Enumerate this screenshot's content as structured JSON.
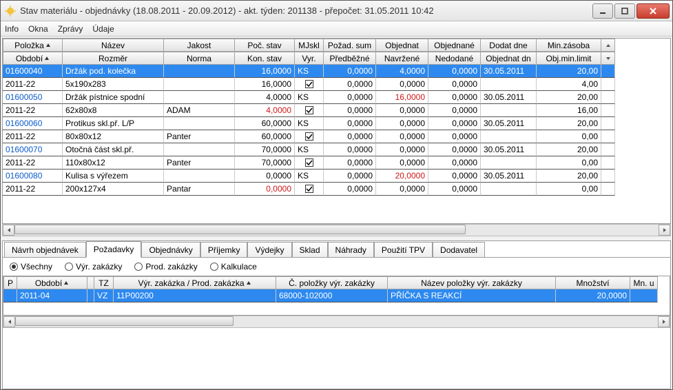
{
  "window": {
    "title": "Stav materiálu - objednávky (18.08.2011 - 20.09.2012) - akt. týden: 201138 - přepočet: 31.05.2011 10:42"
  },
  "menu": {
    "info": "Info",
    "okna": "Okna",
    "zpravy": "Zprávy",
    "udaje": "Údaje"
  },
  "hdr1": {
    "c0": "Položka",
    "c1": "Název",
    "c2": "Jakost",
    "c3": "Poč. stav",
    "c4": "MJskl",
    "c5": "Požad. sum",
    "c6": "Objednat",
    "c7": "Objednané",
    "c8": "Dodat dne",
    "c9": "Min.zásoba"
  },
  "hdr2": {
    "c0": "Období",
    "c1": "Rozměr",
    "c2": "Norma",
    "c3": "Kon. stav",
    "c4": "Vyr.",
    "c5": "Předběžné",
    "c6": "Navržené",
    "c7": "Nedodané",
    "c8": "Objednat dn",
    "c9": "Obj.min.limit"
  },
  "rows": [
    {
      "a": {
        "c0": "01600040",
        "c1": "Držák pod. kolečka",
        "c2": "",
        "c3": "16,0000",
        "c4": "KS",
        "c5": "0,0000",
        "c6": "4,0000",
        "c7": "0,0000",
        "c8": "30.05.2011",
        "c9": "20,00",
        "sel": true
      },
      "b": {
        "c0": "2011-22",
        "c1": "5x190x283",
        "c2": "",
        "c3": "16,0000",
        "chk": true,
        "c5": "0,0000",
        "c6": "0,0000",
        "c7": "0,0000",
        "c8": "",
        "c9": "4,00"
      }
    },
    {
      "a": {
        "c0": "01600050",
        "c1": "Držák pístnice spodní",
        "c2": "",
        "c3": "4,0000",
        "c4": "KS",
        "c5": "0,0000",
        "c6": "16,0000",
        "c6red": true,
        "c7": "0,0000",
        "c8": "30.05.2011",
        "c9": "20,00"
      },
      "b": {
        "c0": "2011-22",
        "c1": "62x80x8",
        "c2": "ADAM",
        "c3": "4,0000",
        "c3red": true,
        "chk": true,
        "c5": "0,0000",
        "c6": "0,0000",
        "c7": "0,0000",
        "c8": "",
        "c9": "16,00"
      }
    },
    {
      "a": {
        "c0": "01600060",
        "c1": "Protikus skl.př. L/P",
        "c2": "",
        "c3": "60,0000",
        "c4": "KS",
        "c5": "0,0000",
        "c6": "0,0000",
        "c7": "0,0000",
        "c8": "30.05.2011",
        "c9": "20,00"
      },
      "b": {
        "c0": "2011-22",
        "c1": "80x80x12",
        "c2": "Panter",
        "c3": "60,0000",
        "chk": true,
        "c5": "0,0000",
        "c6": "0,0000",
        "c7": "0,0000",
        "c8": "",
        "c9": "0,00"
      }
    },
    {
      "a": {
        "c0": "01600070",
        "c1": "Otočná část skl.př.",
        "c2": "",
        "c3": "70,0000",
        "c4": "KS",
        "c5": "0,0000",
        "c6": "0,0000",
        "c7": "0,0000",
        "c8": "30.05.2011",
        "c9": "20,00"
      },
      "b": {
        "c0": "2011-22",
        "c1": "110x80x12",
        "c2": "Panter",
        "c3": "70,0000",
        "chk": true,
        "c5": "0,0000",
        "c6": "0,0000",
        "c7": "0,0000",
        "c8": "",
        "c9": "0,00"
      }
    },
    {
      "a": {
        "c0": "01600080",
        "c1": "Kulisa s výřezem",
        "c2": "",
        "c3": "0,0000",
        "c4": "KS",
        "c5": "0,0000",
        "c6": "20,0000",
        "c6red": true,
        "c7": "0,0000",
        "c8": "30.05.2011",
        "c9": "20,00"
      },
      "b": {
        "c0": "2011-22",
        "c1": "200x127x4",
        "c2": "Pantar",
        "c3": "0,0000",
        "c3red": true,
        "chk": true,
        "c5": "0,0000",
        "c6": "0,0000",
        "c7": "0,0000",
        "c8": "",
        "c9": "0,00"
      }
    }
  ],
  "tabs": {
    "t0": "Návrh objednávek",
    "t1": "Požadavky",
    "t2": "Objednávky",
    "t3": "Příjemky",
    "t4": "Výdejky",
    "t5": "Sklad",
    "t6": "Náhrady",
    "t7": "Použití TPV",
    "t8": "Dodavatel"
  },
  "radios": {
    "r0": "Všechny",
    "r1": "Výr. zakázky",
    "r2": "Prod. zakázky",
    "r3": "Kalkulace"
  },
  "bhdr": {
    "c0": "P",
    "c1": "Období",
    "c3": "TZ",
    "c4": "Výr. zakázka / Prod. zakázka",
    "c5": "Č. položky výr. zakázky",
    "c6": "Název položky výr. zakázky",
    "c7": "Množství",
    "c8": "Mn. u"
  },
  "brow": {
    "c1": "2011-04",
    "c3": "VZ",
    "c4": "11P00200",
    "c5": "68000-102000",
    "c6": "PŘÍČKA S REAKCÍ",
    "c7": "20,0000"
  }
}
